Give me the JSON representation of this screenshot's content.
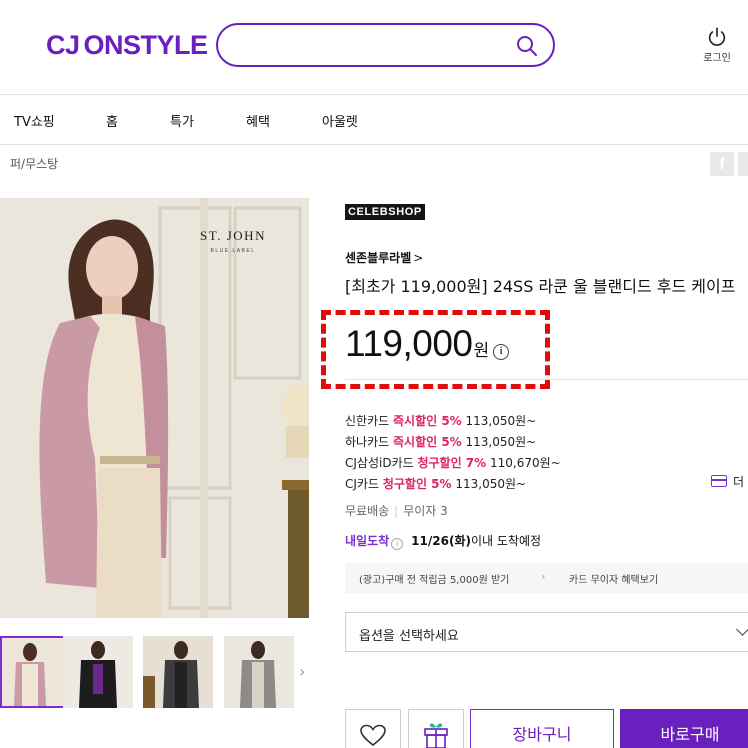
{
  "header": {
    "logo_cj": "CJ",
    "logo_rest": "ONSTYLE",
    "brand_color": "#6a1fbf",
    "search": {
      "value": "",
      "icon": "search-icon"
    },
    "login_label": "로그인"
  },
  "nav": {
    "items": [
      {
        "label": "TV쇼핑"
      },
      {
        "label": "홈"
      },
      {
        "label": "특가"
      },
      {
        "label": "혜택"
      },
      {
        "label": "아울렛"
      }
    ]
  },
  "breadcrumb": "퍼/무스탕",
  "share": {
    "facebook_glyph": "f"
  },
  "gallery": {
    "main_image_brand": "ST. JOHN",
    "main_image_sub": "BLUE LABEL",
    "thumbnail_count": 4,
    "next_glyph": "›"
  },
  "product": {
    "badge": "CELEBSHOP",
    "brand": "센존블루라벨",
    "brand_arrow": ">",
    "title": "[최초가 119,000원] 24SS 라쿤 울 블랜디드 후드 케이프",
    "price": "119,000",
    "currency": "원",
    "info_glyph": "i",
    "highlight_color": "#e00b0b"
  },
  "card_discounts": [
    {
      "card": "신한카드 ",
      "type": "즉시할인 5%",
      "price": " 113,050원~"
    },
    {
      "card": "하나카드 ",
      "type": "즉시할인 5%",
      "price": " 113,050원~"
    },
    {
      "card": "CJ삼성iD카드 ",
      "type": "청구할인 7%",
      "price": " 110,670원~"
    },
    {
      "card": "CJ카드 ",
      "type": "청구할인 5%",
      "price": " 113,050원~"
    }
  ],
  "discount_accent": "#e0255e",
  "more_label": "더",
  "shipping": {
    "free": "무료배송",
    "separator": "|",
    "installment": "무이자 3"
  },
  "delivery": {
    "tag": "내일도착",
    "date": "11/26(화)",
    "suffix": "이내 도착예정"
  },
  "promo": {
    "left": "(광고)구매 전 적립금 5,000원 받기",
    "chevron": "›",
    "right": "카드 무이자 혜택보기"
  },
  "option": {
    "placeholder": "옵션을 선택하세요"
  },
  "actions": {
    "cart_label": "장바구니",
    "buy_label": "바로구매"
  }
}
